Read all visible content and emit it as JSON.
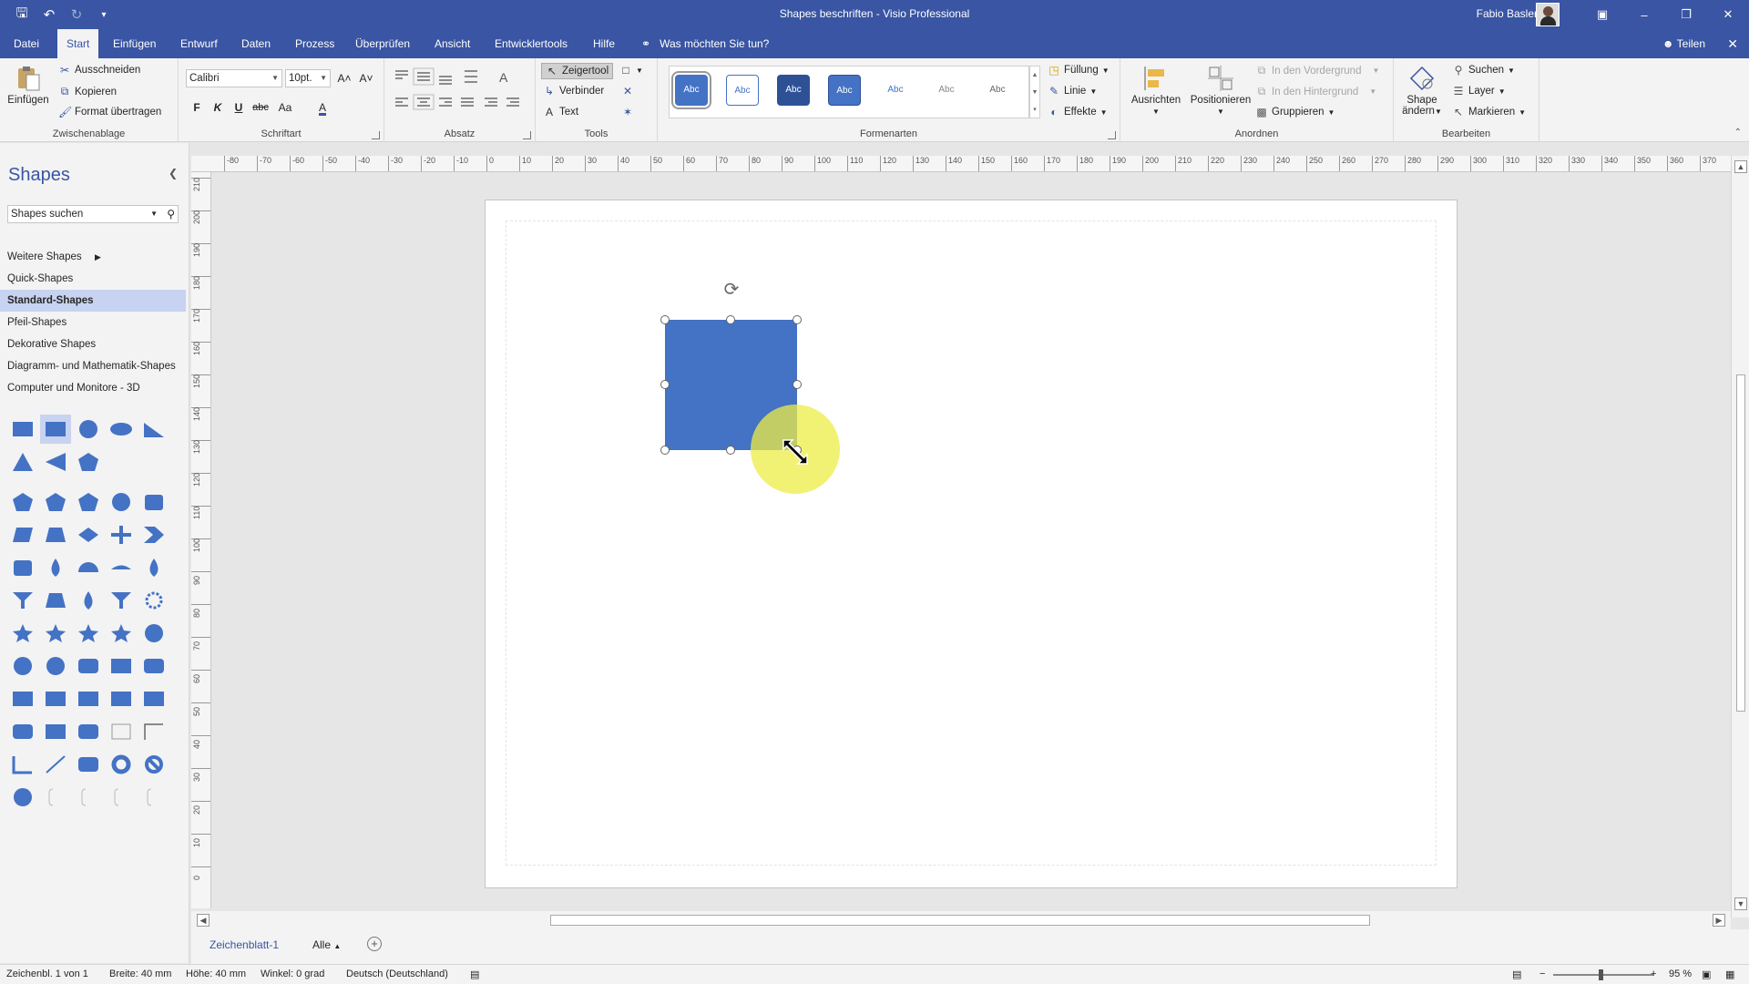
{
  "window": {
    "title": "Shapes beschriften  -  Visio Professional",
    "user_name": "Fabio Basler",
    "qat_icons": [
      "save-icon",
      "undo-icon",
      "redo-icon",
      "customize-icon"
    ],
    "controls": [
      "ribbon-options-icon",
      "minimize-icon",
      "restore-icon",
      "close-icon"
    ]
  },
  "menu": {
    "tabs": [
      "Datei",
      "Start",
      "Einfügen",
      "Entwurf",
      "Daten",
      "Prozess",
      "Überprüfen",
      "Ansicht",
      "Entwicklertools",
      "Hilfe"
    ],
    "active": "Start",
    "tell_me": "Was möchten Sie tun?",
    "share": "Teilen"
  },
  "ribbon": {
    "clipboard": {
      "label": "Zwischenablage",
      "paste": "Einfügen",
      "cut": "Ausschneiden",
      "copy": "Kopieren",
      "format_painter": "Format übertragen"
    },
    "font": {
      "label": "Schriftart",
      "name": "Calibri",
      "size": "10pt.",
      "bold": "F",
      "italic": "K",
      "underline": "U",
      "strike": "abc",
      "case": "Aa",
      "grow": "A˄",
      "shrink": "A˅",
      "color": "A"
    },
    "paragraph": {
      "label": "Absatz"
    },
    "tools": {
      "label": "Tools",
      "pointer": "Zeigertool",
      "connector": "Verbinder",
      "text": "Text"
    },
    "shape_styles": {
      "label": "Formenarten",
      "thumb_label": "Abc",
      "fill": "Füllung",
      "line": "Linie",
      "effects": "Effekte"
    },
    "arrange": {
      "label": "Anordnen",
      "align": "Ausrichten",
      "position": "Positionieren",
      "bring_front": "In den Vordergrund",
      "send_back": "In den Hintergrund",
      "group": "Gruppieren"
    },
    "editing": {
      "label": "Bearbeiten",
      "change_shape_1": "Shape",
      "change_shape_2": "ändern",
      "find": "Suchen",
      "layer": "Layer",
      "select": "Markieren"
    }
  },
  "shapes_panel": {
    "title": "Shapes",
    "search_placeholder": "Shapes suchen",
    "stencils": [
      "Weitere Shapes",
      "Quick-Shapes",
      "Standard-Shapes",
      "Pfeil-Shapes",
      "Dekorative Shapes",
      "Diagramm- und Mathematik-Shapes",
      "Computer und Monitore - 3D"
    ],
    "active_stencil": "Standard-Shapes"
  },
  "ruler": {
    "h_labels": [
      "-80",
      "-70",
      "-60",
      "-50",
      "-40",
      "-30",
      "-20",
      "-10",
      "0",
      "10",
      "20",
      "30",
      "40",
      "50",
      "60",
      "70",
      "80",
      "90",
      "100",
      "110",
      "120",
      "130",
      "140",
      "150",
      "160",
      "170",
      "180",
      "190",
      "200",
      "210",
      "220",
      "230",
      "240",
      "250",
      "260",
      "270",
      "280",
      "290",
      "300",
      "310",
      "320",
      "330",
      "340",
      "350",
      "360",
      "370"
    ],
    "v_labels": [
      "210",
      "200",
      "190",
      "180",
      "170",
      "160",
      "150",
      "140",
      "130",
      "120",
      "110",
      "100",
      "90",
      "80",
      "70",
      "60",
      "50",
      "40",
      "30",
      "20",
      "10",
      "0"
    ]
  },
  "sheets": {
    "current": "Zeichenblatt-1",
    "all": "Alle"
  },
  "status": {
    "page": "Zeichenbl. 1 von 1",
    "width": "Breite: 40 mm",
    "height": "Höhe: 40 mm",
    "angle": "Winkel: 0 grad",
    "language": "Deutsch (Deutschland)",
    "zoom": "95 %",
    "zoom_level": 0.95
  },
  "colors": {
    "accent": "#3955a3",
    "shape_fill": "#4472c4",
    "highlight": "#ecec46"
  }
}
